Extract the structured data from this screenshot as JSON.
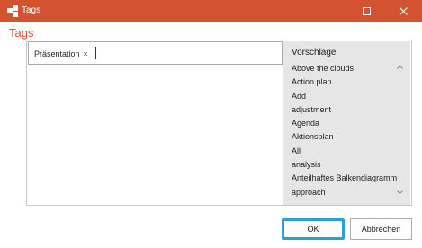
{
  "window": {
    "title": "Tags",
    "accent": "#d35230"
  },
  "heading": "Tags",
  "tag_input": {
    "chips": [
      {
        "label": "Präsentation",
        "remove": "×"
      }
    ],
    "value": ""
  },
  "suggestions": {
    "title": "Vorschläge",
    "items": [
      "Above the clouds",
      "Action plan",
      "Add",
      "adjustment",
      "Agenda",
      "Aktionsplan",
      "All",
      "analysis",
      "Anteilhaftes Balkendiagramm",
      "approach"
    ]
  },
  "buttons": {
    "ok": "OK",
    "cancel": "Abbrechen"
  },
  "icons": {
    "app": "tags-app-icon",
    "maximize": "maximize-icon",
    "close": "close-icon",
    "scroll_up": "chevron-up-icon",
    "scroll_down": "chevron-down-icon"
  }
}
